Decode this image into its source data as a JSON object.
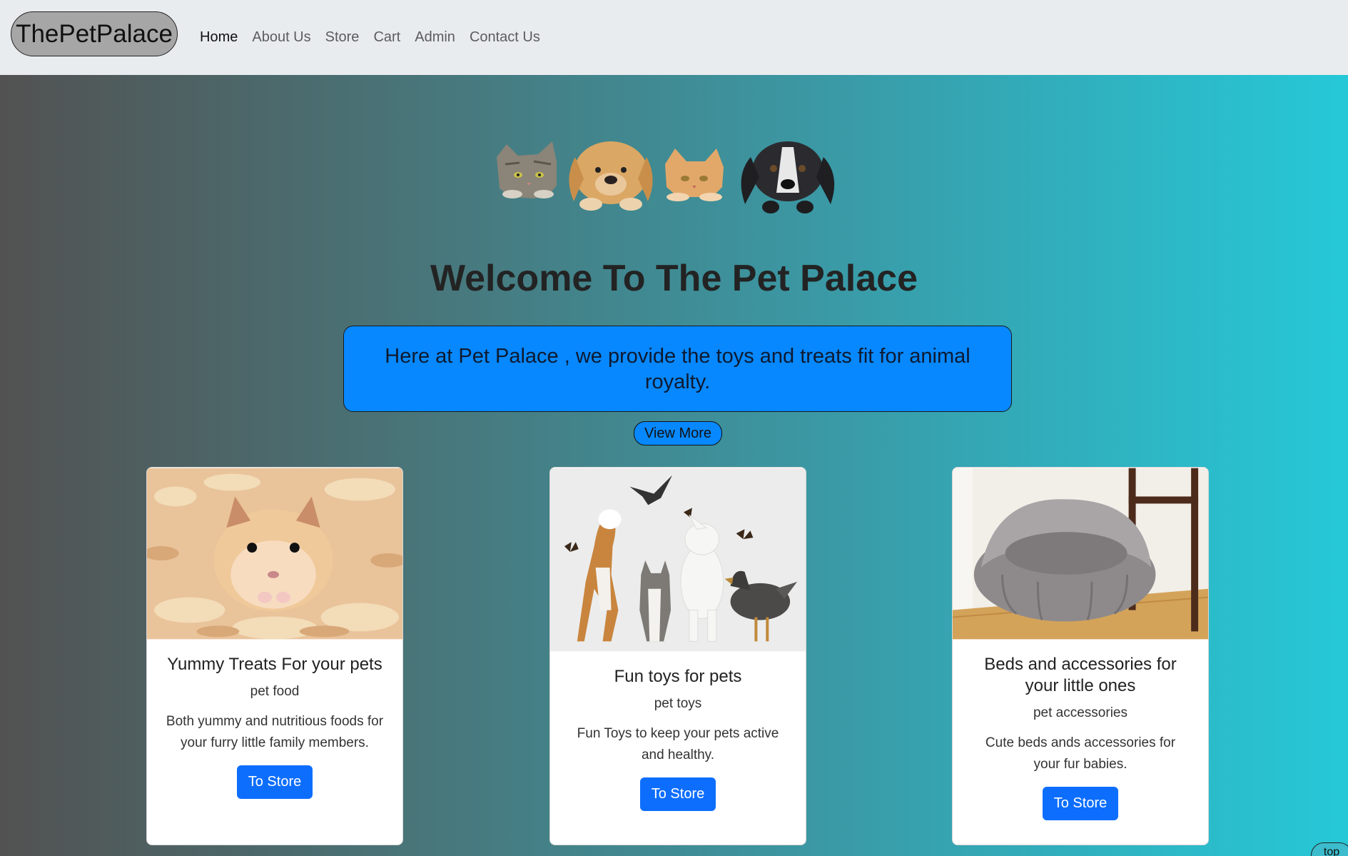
{
  "navbar": {
    "brand": "ThePetPalace",
    "links": [
      {
        "label": "Home",
        "active": true
      },
      {
        "label": "About Us"
      },
      {
        "label": "Store"
      },
      {
        "label": "Cart"
      },
      {
        "label": "Admin"
      },
      {
        "label": "Contact Us"
      }
    ]
  },
  "hero": {
    "title": "Welcome To The Pet Palace",
    "tagline": "Here at Pet Palace , we provide the toys and treats fit for animal royalty.",
    "view_more": "View More"
  },
  "cards": [
    {
      "title": "Yummy Treats For your pets",
      "subtitle": "pet food",
      "text": "Both yummy and nutritious foods for your furry little family members.",
      "button": "To Store",
      "image": "hamster-photo"
    },
    {
      "title": "Fun toys for pets",
      "subtitle": "pet toys",
      "text": "Fun Toys to keep your pets active and healthy.",
      "button": "To Store",
      "image": "pets-playing-photo"
    },
    {
      "title": "Beds and accessories for your little ones",
      "subtitle": "pet accessories",
      "text": "Cute beds ands accessories for your fur babies.",
      "button": "To Store",
      "image": "pet-bed-photo"
    }
  ],
  "top_button": "top",
  "colors": {
    "navbar_bg": "#e9ecef",
    "gradient_start": "#525252",
    "gradient_end": "#26c8d8",
    "tagline_bg": "#0788ff",
    "button_blue": "#0d6efd"
  }
}
